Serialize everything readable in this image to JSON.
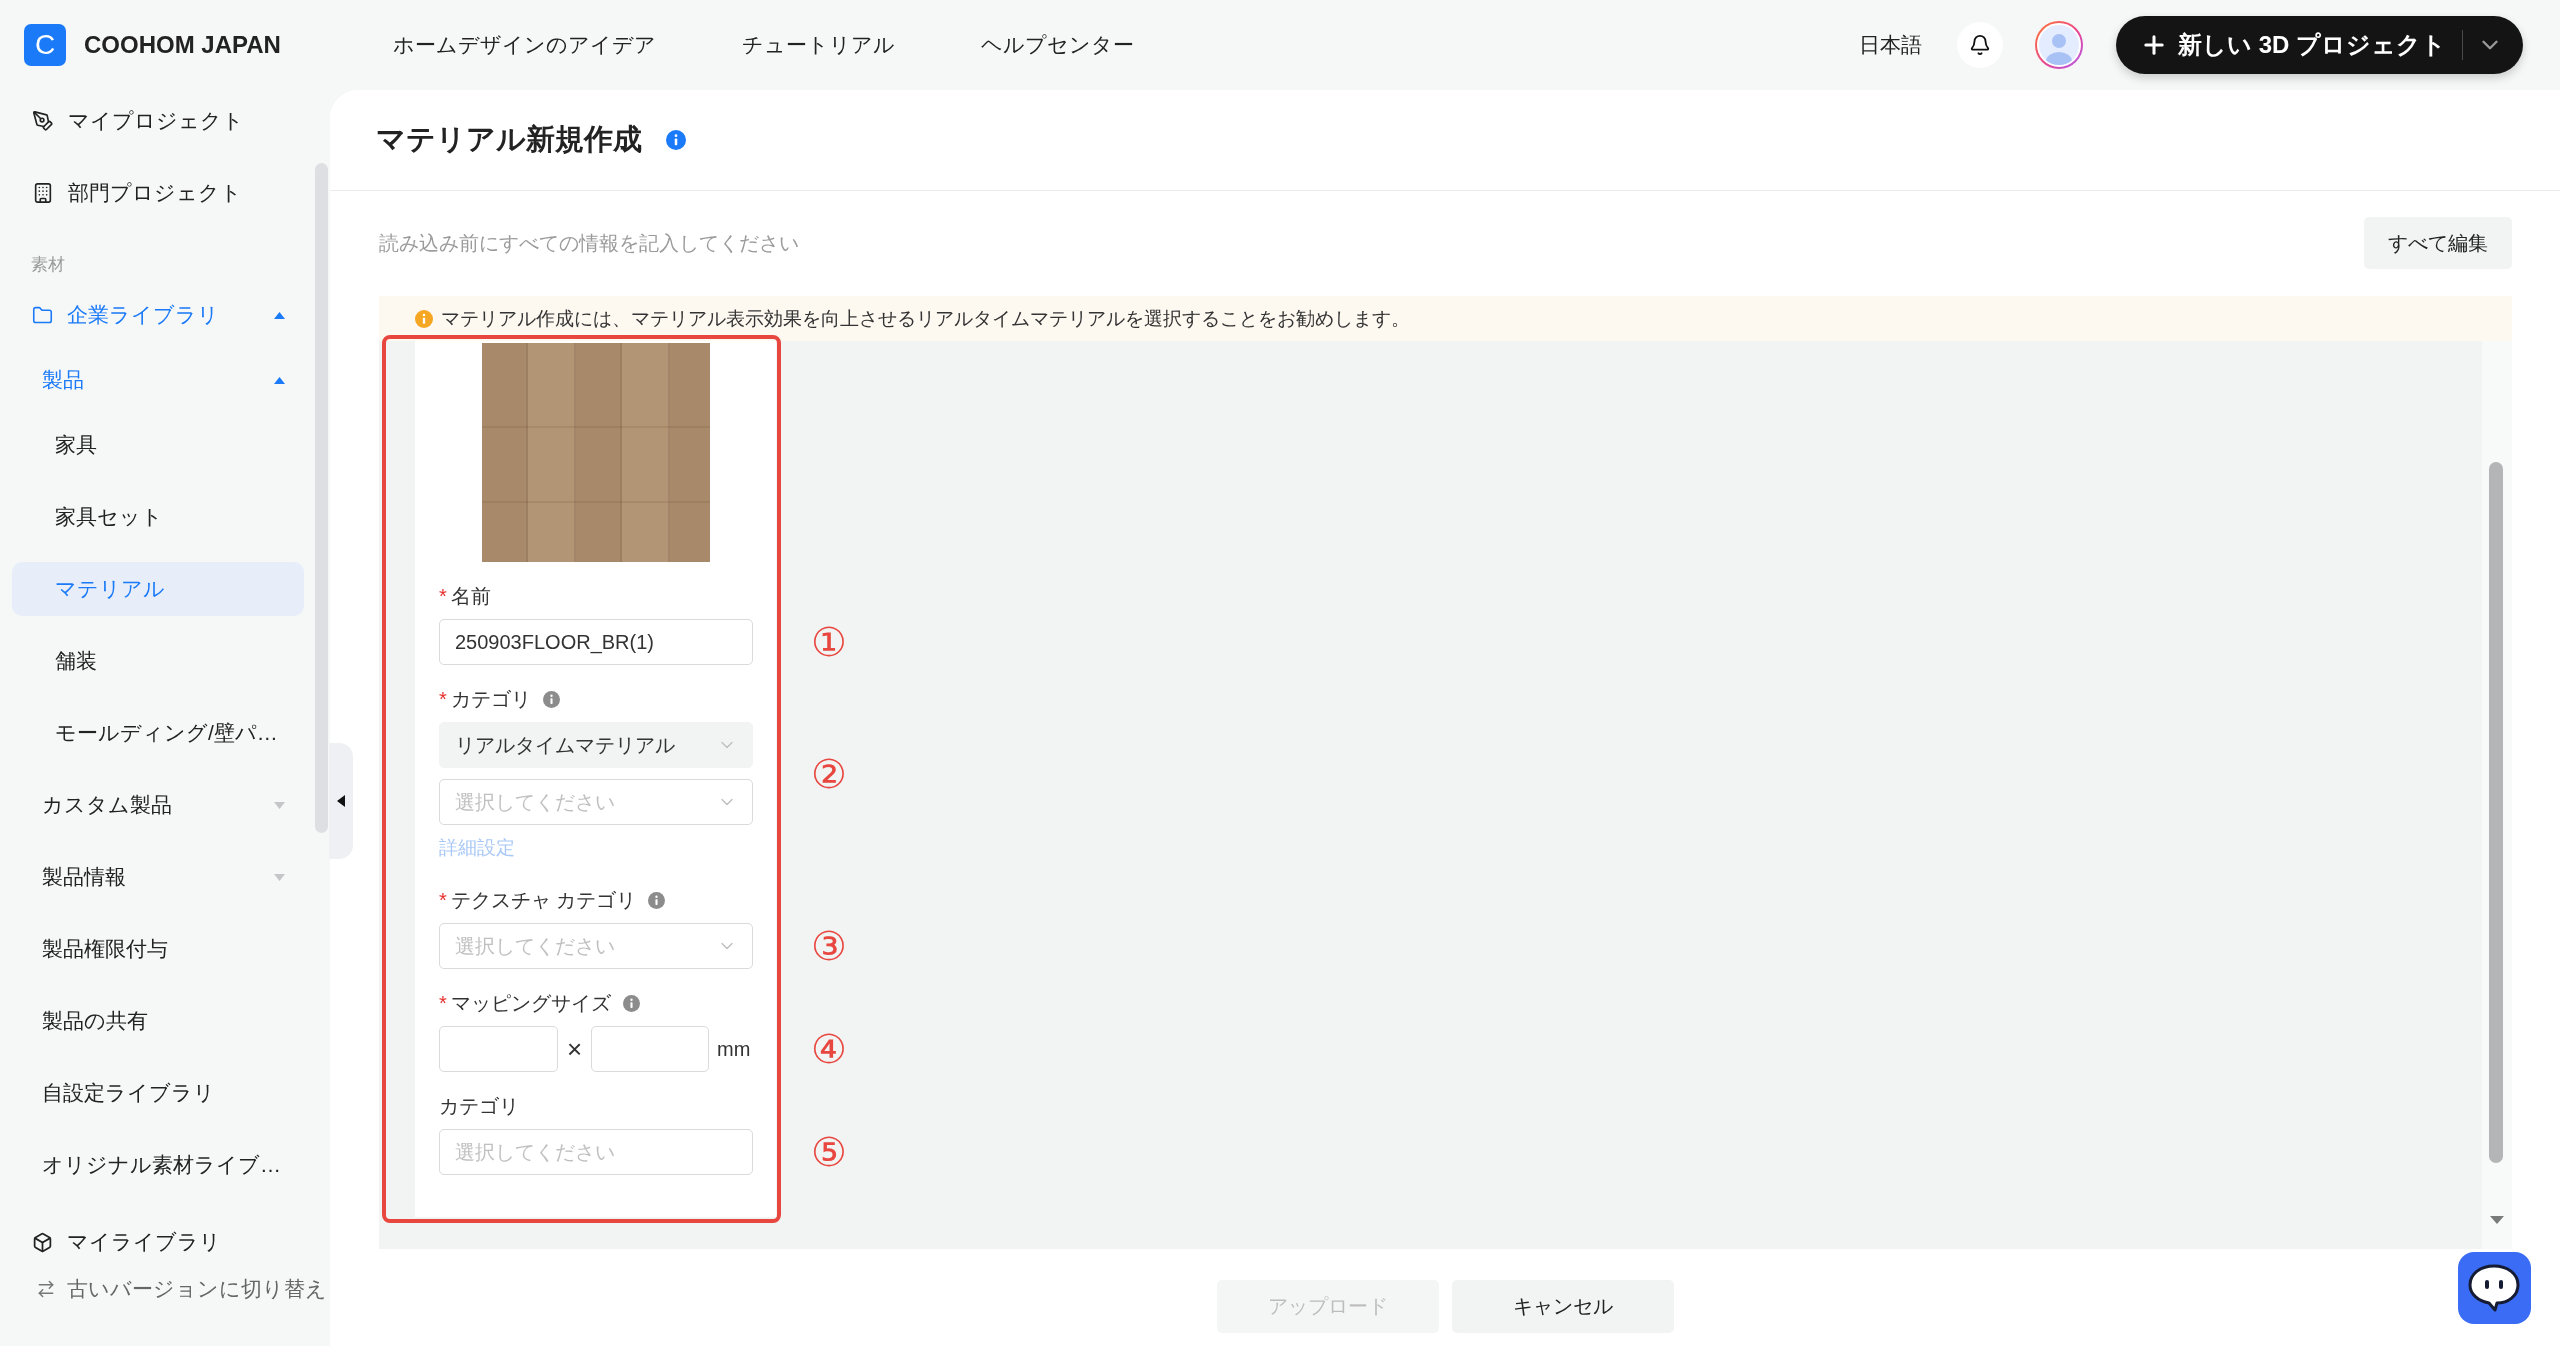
{
  "header": {
    "logo": "C",
    "brand": "COOHOM JAPAN",
    "nav": [
      {
        "label": "ホームデザインのアイデア"
      },
      {
        "label": "チュートリアル"
      },
      {
        "label": "ヘルプセンター"
      }
    ],
    "language": "日本語",
    "new_project_button": "新しい 3D プロジェクト"
  },
  "sidebar": {
    "projects": [
      {
        "label": "マイプロジェクト",
        "selected": false
      },
      {
        "label": "部門プロジェクト",
        "selected": false
      }
    ],
    "section_title": "素材",
    "tree": [
      {
        "label": "企業ライブラリ",
        "expanded": true,
        "selected": false,
        "children": [
          {
            "label": "製品",
            "expanded": true,
            "selected": false,
            "children": [
              {
                "label": "家具",
                "selected": false
              },
              {
                "label": "家具セット",
                "selected": false
              },
              {
                "label": "マテリアル",
                "selected": true
              },
              {
                "label": "舗装",
                "selected": false
              },
              {
                "label": "モールディング/壁パ…",
                "selected": false
              }
            ]
          },
          {
            "label": "カスタム製品",
            "expanded": false,
            "selected": false
          },
          {
            "label": "製品情報",
            "expanded": false,
            "selected": false
          },
          {
            "label": "製品権限付与",
            "selected": false
          },
          {
            "label": "製品の共有",
            "selected": false
          },
          {
            "label": "自設定ライブラリ",
            "selected": false
          },
          {
            "label": "オリジナル素材ライブ…",
            "selected": false
          }
        ]
      }
    ],
    "my_library": {
      "label": "マイライブラリ",
      "selected": false
    },
    "switch_version": {
      "label": "古いバージョンに切り替え"
    }
  },
  "page": {
    "title": "マテリアル新規作成",
    "instruction": "読み込み前にすべての情報を記入してください",
    "edit_all_button": "すべて編集",
    "notice": "マテリアル作成には、マテリアル表示効果を向上させるリアルタイムマテリアルを選択することをお勧めします。"
  },
  "form": {
    "fields": [
      {
        "kind": "text",
        "required_mark": "*",
        "label": "名前",
        "info": false,
        "value": "250903FLOOR_BR(1)",
        "marker": "①"
      },
      {
        "kind": "selects",
        "required_mark": "*",
        "label": "カテゴリ",
        "info": true,
        "selects": [
          {
            "value": "リアルタイムマテリアル",
            "disabled": true
          },
          {
            "placeholder": "選択してください",
            "disabled": false
          }
        ],
        "link": "詳細設定",
        "marker": "②"
      },
      {
        "kind": "select",
        "required_mark": "*",
        "label": "テクスチャ カテゴリ",
        "info": true,
        "placeholder": "選択してください",
        "marker": "③"
      },
      {
        "kind": "size",
        "required_mark": "*",
        "label": "マッピングサイズ",
        "info": true,
        "separator": "×",
        "unit": "mm",
        "marker": "④"
      },
      {
        "kind": "text",
        "label": "カテゴリ",
        "info": false,
        "placeholder": "選択してください",
        "marker": "⑤"
      }
    ]
  },
  "footer": {
    "buttons": [
      {
        "label": "アップロード",
        "disabled": true
      },
      {
        "label": "キャンセル",
        "disabled": false
      }
    ]
  }
}
